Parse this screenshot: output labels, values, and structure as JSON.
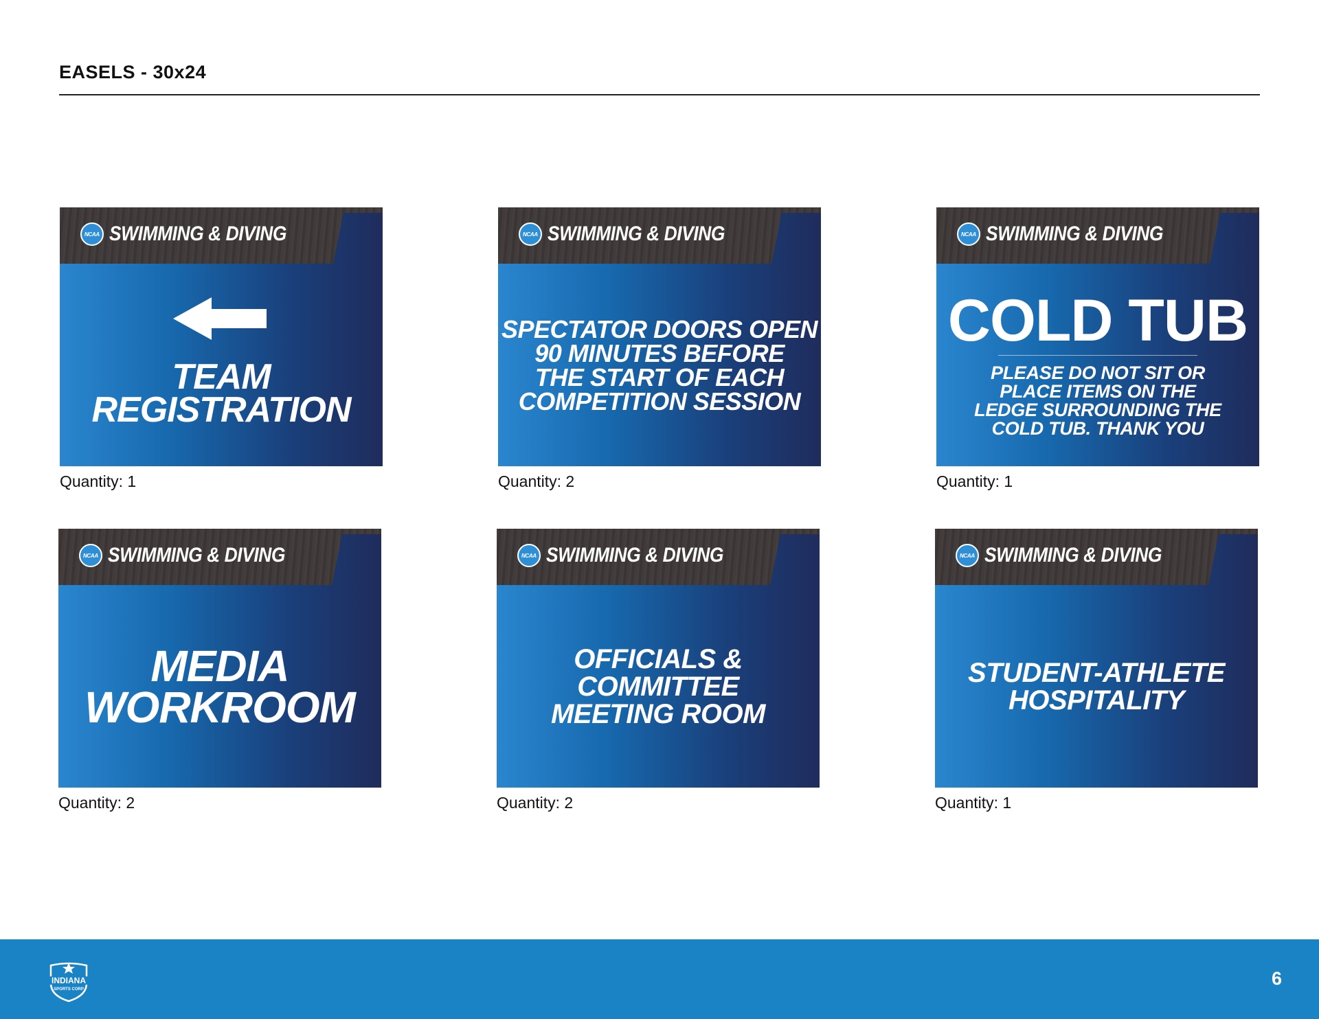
{
  "page": {
    "title": "EASELS - 30x24",
    "page_number": "6"
  },
  "brand": {
    "ncaa_logo_text": "NCAA",
    "header_text": "SWIMMING & DIVING",
    "colors": {
      "sign_gradient_start": "#2a86cf",
      "sign_gradient_end": "#1f2c5c",
      "header_wood": "#3d3837",
      "footer_blue": "#1983c6"
    }
  },
  "signs": [
    {
      "body": "TEAM\nREGISTRATION",
      "icon": "left-arrow-icon",
      "quantity": "Quantity: 1"
    },
    {
      "body": "SPECTATOR DOORS OPEN\n90 MINUTES BEFORE\nTHE  START OF EACH\nCOMPETITION SESSION",
      "quantity": "Quantity: 2"
    },
    {
      "body": "COLD TUB",
      "subtext": "PLEASE DO NOT SIT OR\nPLACE ITEMS ON THE\nLEDGE SURROUNDING THE\nCOLD TUB. THANK YOU",
      "quantity": "Quantity: 1"
    },
    {
      "body": "MEDIA\nWORKROOM",
      "quantity": "Quantity: 2"
    },
    {
      "body": "OFFICIALS & COMMITTEE\nMEETING ROOM",
      "quantity": "Quantity: 2"
    },
    {
      "body": "STUDENT-ATHLETE\nHOSPITALITY",
      "quantity": "Quantity: 1"
    }
  ],
  "footer": {
    "logo_icon": "indiana-sports-corp-logo",
    "logo_text_top": "INDIANA",
    "logo_text_bottom": "SPORTS CORP"
  }
}
